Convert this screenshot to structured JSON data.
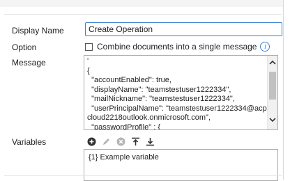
{
  "form": {
    "display_name_label": "Display Name",
    "display_name_value": "Create Operation",
    "option_label": "Option",
    "combine_label": "Combine documents into a single message",
    "combine_checked": false,
    "message_label": "Message",
    "message_value": "'\n{\n  \"accountEnabled\": true,\n  \"displayName\": \"teamstestuser1222334\",\n  \"mailNickname\": \"teamstestuser1222334\",\n  \"userPrincipalName\": \"teamstestuser1222334@acpcloud2218outlook.onmicrosoft.com\",\n  \"passwordProfile\" : {\n    \"forceChangePasswordNextSignIn\": true,",
    "variables_label": "Variables",
    "variables_value": "{1} Example variable"
  },
  "icons": {
    "info": "info-icon",
    "add": "add-circle-icon",
    "edit": "pencil-icon",
    "delete": "delete-circle-icon",
    "move_top": "move-to-top-icon",
    "move_bottom": "move-to-bottom-icon"
  },
  "colors": {
    "accent": "#3b7fd1",
    "info": "#3c86d6"
  }
}
